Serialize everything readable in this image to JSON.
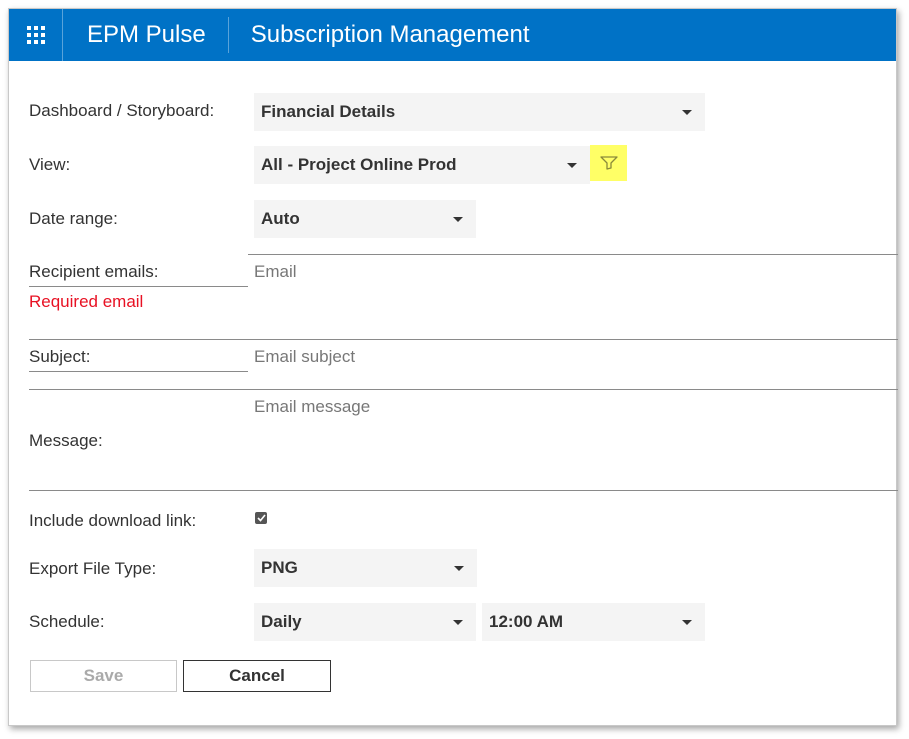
{
  "header": {
    "app_name": "EPM Pulse",
    "page_title": "Subscription Management"
  },
  "form": {
    "dashboard": {
      "label": "Dashboard / Storyboard:",
      "value": "Financial Details"
    },
    "view": {
      "label": "View:",
      "value": "All - Project Online Prod"
    },
    "date_range": {
      "label": "Date range:",
      "value": "Auto"
    },
    "recipients": {
      "label": "Recipient emails:",
      "placeholder": "Email",
      "error": "Required email"
    },
    "subject": {
      "label": "Subject:",
      "placeholder": "Email subject"
    },
    "message": {
      "label": "Message:",
      "placeholder": "Email message"
    },
    "download_link": {
      "label": "Include download link:",
      "checked": true
    },
    "export_type": {
      "label": "Export File Type:",
      "value": "PNG"
    },
    "schedule": {
      "label": "Schedule:",
      "frequency": "Daily",
      "time": "12:00 AM"
    }
  },
  "buttons": {
    "save": "Save",
    "cancel": "Cancel"
  },
  "colors": {
    "header_bg": "#0072c6",
    "filter_highlight": "#ffff66",
    "error": "#e81123"
  },
  "icons": {
    "app_launcher": "waffle-icon",
    "filter": "filter-icon",
    "caret": "caret-down-icon",
    "check": "checkmark-icon"
  }
}
